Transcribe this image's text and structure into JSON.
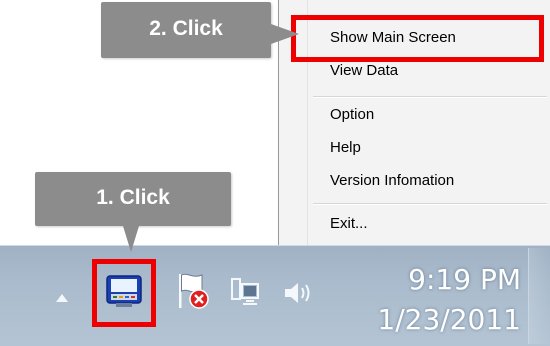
{
  "callouts": {
    "step1": "1. Click",
    "step2": "2. Click"
  },
  "context_menu": {
    "items": [
      {
        "label": "Show Main Screen"
      },
      {
        "label": "View Data"
      },
      {
        "label": "Option"
      },
      {
        "label": "Help"
      },
      {
        "label": "Version Infomation"
      },
      {
        "label": "Exit..."
      }
    ]
  },
  "taskbar": {
    "clock_time": "9:19 PM",
    "clock_date": "1/23/2011",
    "icons": [
      "tray-overflow-arrow-icon",
      "app-tray-icon",
      "action-center-flag-icon",
      "network-icon",
      "volume-icon"
    ]
  },
  "colors": {
    "highlight": "#ef0000",
    "callout": "#8c8c8c",
    "menu_bg": "#f3f3f3"
  }
}
